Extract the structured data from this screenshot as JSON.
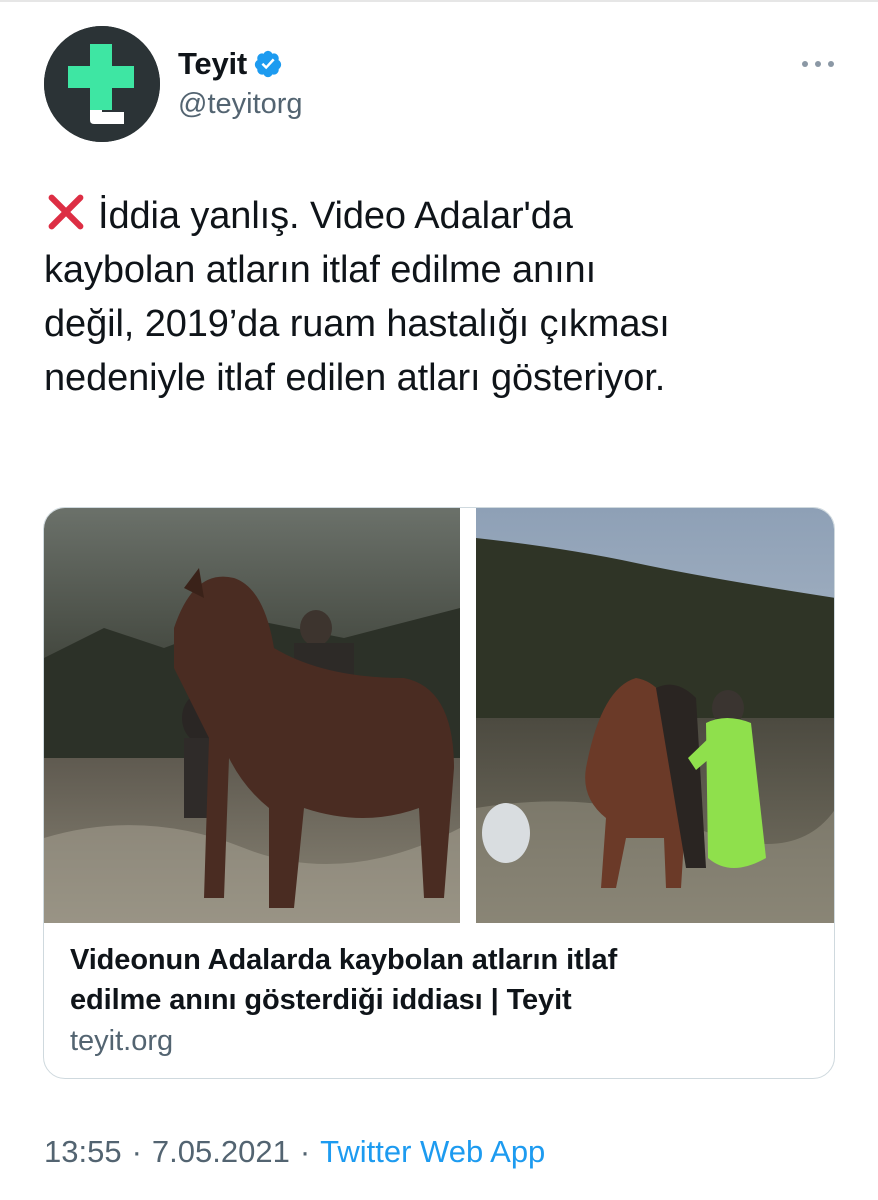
{
  "tweet": {
    "author": {
      "display_name": "Teyit",
      "handle": "@teyitorg",
      "verified": true,
      "avatar_icon": "teyit-logo-icon"
    },
    "more_icon": "more-dots-icon",
    "text_lines": [
      "İddia yanlış. Video Adalar'da",
      "kaybolan atların itlaf edilme anını",
      "değil, 2019’da ruam hastalığı çıkması",
      "nedeniyle itlaf edilen atları gösteriyor."
    ],
    "lead_emoji": "cross-mark-icon",
    "card": {
      "title_lines": [
        "Videonun Adalarda kaybolan atların itlaf",
        "edilme anını gösterdiği iddiası | Teyit"
      ],
      "domain": "teyit.org"
    },
    "meta": {
      "time": "13:55",
      "separator": "·",
      "date": "7.05.2021",
      "source": "Twitter Web App"
    }
  },
  "colors": {
    "text": "#0f1419",
    "secondary": "#536471",
    "link": "#1d9bf0",
    "verified": "#1d9bf0",
    "brand_green": "#3ee6a3",
    "avatar_bg": "#2b3336",
    "cross_red": "#dd2e44",
    "card_border": "#cfd9de"
  }
}
